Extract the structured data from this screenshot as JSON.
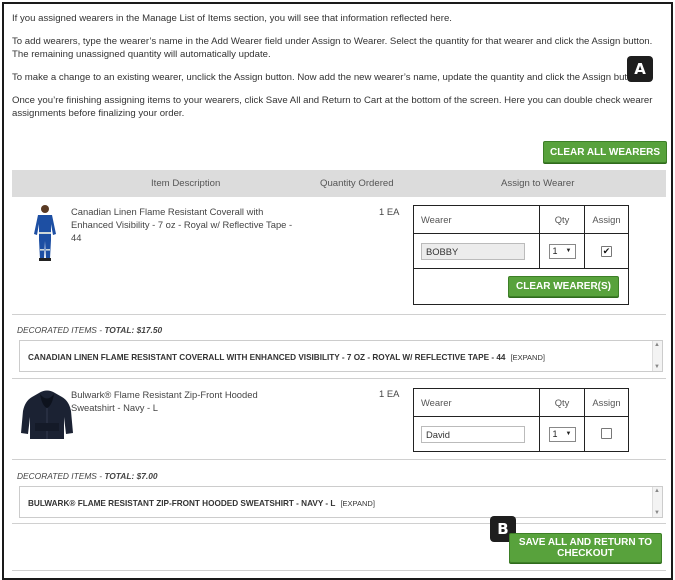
{
  "intro": {
    "p1": "If you assigned wearers in the Manage List of Items section, you will see that information reflected here.",
    "p2": "To add wearers, type the wearer’s name in the Add Wearer field under Assign to Wearer. Select the quantity for that wearer and click the Assign button. The remaining unassigned quantity will automatically update.",
    "p3": "To make a change to an existing wearer, unclick the Assign button. Now add the new wearer’s name, update the quantity and click the Assign button.",
    "p4": "Once you’re finishing assigning items to your wearers, click Save All and Return to Cart at the bottom of the screen. Here you can double check wearer assignments before finalizing your order."
  },
  "badges": {
    "a": "A",
    "b": "B"
  },
  "buttons": {
    "clear_all": "CLEAR ALL WEARERS",
    "clear_wearers": "CLEAR WEARER(S)",
    "save_all": "SAVE ALL AND RETURN TO CHECKOUT"
  },
  "table": {
    "headers": [
      "Item Description",
      "Quantity Ordered",
      "Assign to Wearer"
    ],
    "assign_headers": {
      "wearer": "Wearer",
      "qty": "Qty",
      "assign": "Assign"
    }
  },
  "items": [
    {
      "description": "Canadian Linen Flame Resistant Coverall with Enhanced Visibility - 7 oz - Royal w/ Reflective Tape - 44",
      "quantity": "1 EA",
      "wearer": "BOBBY",
      "qty": "1",
      "assigned": true,
      "decorated_label": "DECORATED ITEMS - ",
      "decorated_total": "TOTAL: $17.50",
      "decorated_item": "CANADIAN LINEN FLAME RESISTANT COVERALL WITH ENHANCED VISIBILITY - 7 OZ - ROYAL W/ REFLECTIVE TAPE - 44",
      "expand": "[EXPAND]"
    },
    {
      "description": "Bulwark® Flame Resistant Zip-Front Hooded Sweatshirt - Navy - L",
      "quantity": "1 EA",
      "wearer": "David",
      "qty": "1",
      "assigned": false,
      "decorated_label": "DECORATED ITEMS - ",
      "decorated_total": "TOTAL: $7.00",
      "decorated_item": "BULWARK® FLAME RESISTANT ZIP-FRONT HOODED SWEATSHIRT - NAVY - L",
      "expand": "[EXPAND]"
    }
  ],
  "colors": {
    "accent": "#58a23c",
    "header_bg": "#dcdcdc",
    "badge": "#1e1e1e"
  }
}
